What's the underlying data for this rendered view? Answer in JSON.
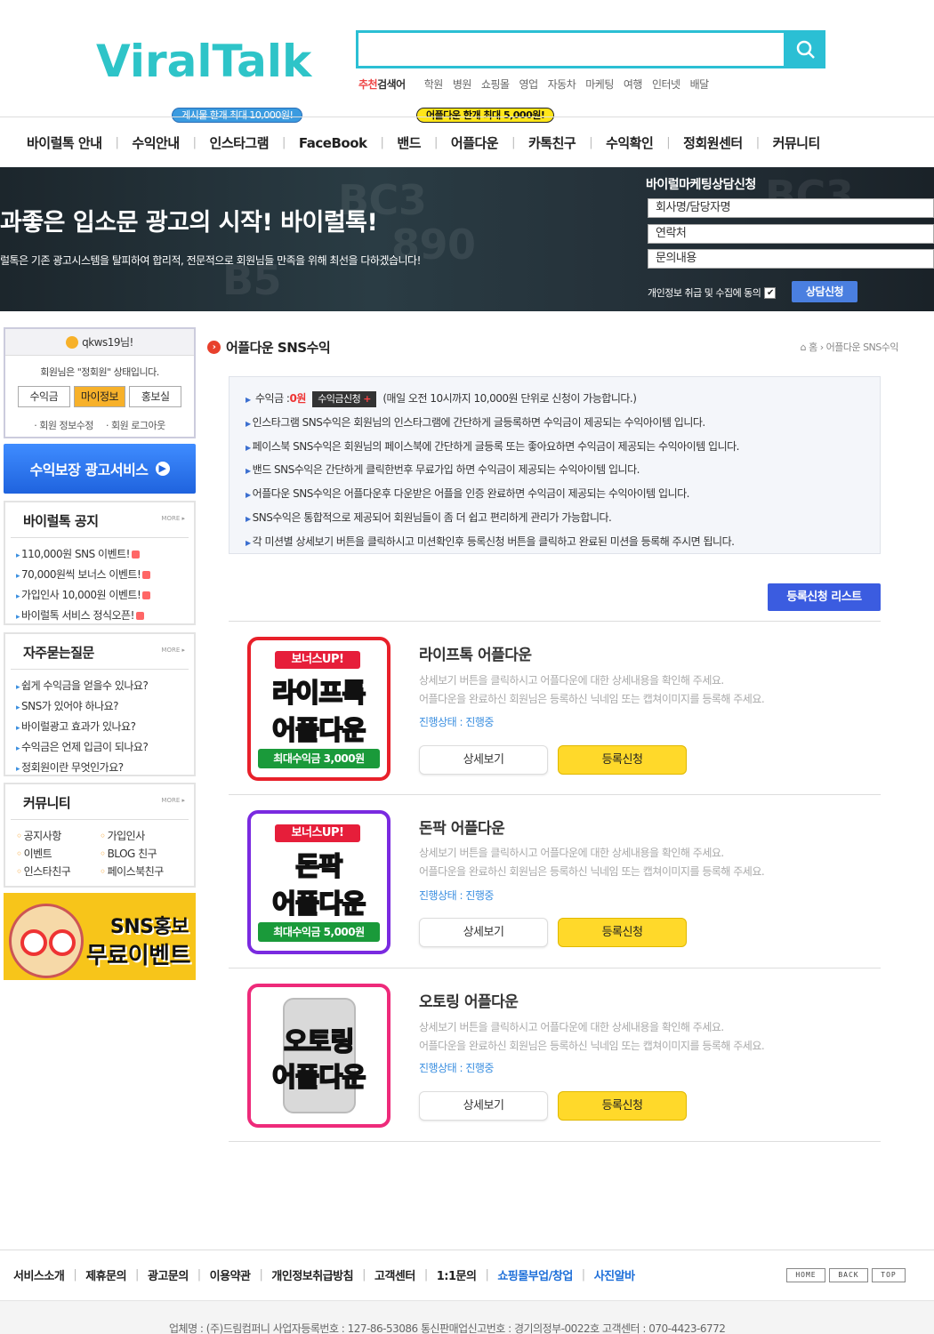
{
  "brand": {
    "logo": "ViralTalk",
    "accent": "#2bbfd4"
  },
  "search": {
    "recommend_label_1": "추천",
    "recommend_label_2": "검색어",
    "keywords": [
      "학원",
      "병원",
      "쇼핑몰",
      "영업",
      "자동차",
      "마케팅",
      "여행",
      "인터넷",
      "배달"
    ]
  },
  "bubbles": {
    "posts": "게시물 한개 최대 10,000원!",
    "appdown": "어플다운 한개 최대 5,000원!"
  },
  "nav": [
    "바이럴톡 안내",
    "수익안내",
    "인스타그램",
    "FaceBook",
    "밴드",
    "어플다운",
    "카톡친구",
    "수익확인",
    "정회원센터",
    "커뮤니티"
  ],
  "banner": {
    "title": "과좋은 입소문 광고의 시작! 바이럴톡!",
    "subtitle": "럴톡은 기존 광고시스템을 탈피하여 합리적, 전문적으로 회원님들 만족을 위해 최선을 다하겠습니다!",
    "consult_title": "바이럴마케팅상담신청",
    "fields": [
      "회사명/담당자명",
      "연락처",
      "문의내용"
    ],
    "privacy": "개인정보 취급 및 수집에 동의",
    "submit": "상담신청"
  },
  "login": {
    "user": "qkws19님!",
    "status": "회원님은 \"정회원\" 상태입니다.",
    "buttons": [
      "수익금",
      "마이정보",
      "홍보실"
    ],
    "links": [
      "· 회원 정보수정",
      "· 회원 로그아웃"
    ]
  },
  "side_banner": "수익보장 광고서비스",
  "notice": {
    "title": "바이럴톡 공지",
    "more": "MORE ▸",
    "items": [
      "110,000원 SNS 이벤트!",
      "70,000원씩 보너스 이벤트!",
      "가입인사 10,000원 이벤트!",
      "바이럴톡 서비스 정식오픈!"
    ]
  },
  "faq": {
    "title": "자주묻는질문",
    "more": "MORE ▸",
    "items": [
      "쉽게 수익금을 얻을수 있나요?",
      "SNS가 있어야 하나요?",
      "바이럴광고 효과가 있나요?",
      "수익금은 언제 입금이 되나요?",
      "정회원이란 무엇인가요?"
    ]
  },
  "community": {
    "title": "커뮤니티",
    "more": "MORE ▸",
    "items": [
      "공지사항",
      "가입인사",
      "이벤트",
      "BLOG 친구",
      "인스타친구",
      "페이스북친구"
    ]
  },
  "event_banner": {
    "line1": "SNS홍보",
    "line2": "무료이벤트"
  },
  "page": {
    "title": "어플다운 SNS수익",
    "breadcrumb": "홈 › 어플다운 SNS수익",
    "income_label": "수익금 :",
    "income_value": "0원",
    "income_button": "수익금신청",
    "income_note": "(매일 오전 10시까지 10,000원 단위로 신청이 가능합니다.)",
    "info": [
      "인스타그램 SNS수익은 회원님의 인스타그램에 간단하게 글등록하면 수익금이 제공되는 수익아이템 입니다.",
      "페이스북 SNS수익은 회원님의 페이스북에 간단하게 글등록 또는 좋아요하면 수익금이 제공되는 수익아이템 입니다.",
      "밴드 SNS수익은 간단하게 클릭한번후 무료가입 하면 수익금이 제공되는 수익아이템 입니다.",
      "어플다운 SNS수익은 어플다운후 다운받은 어플을 인증 완료하면 수익금이 제공되는 수익아이템 입니다.",
      "SNS수익은 통합적으로 제공되어 회원님들이 좀 더 쉽고 편리하게 관리가 가능합니다.",
      "각 미션별 상세보기 버튼을 클릭하시고 미션확인후 등록신청 버튼을 클릭하고 완료된 미션을 등록해 주시면 됩니다."
    ],
    "reg_list_button": "등록신청 리스트"
  },
  "items": [
    {
      "card_tag": "보너스UP!",
      "card_t1": "라이프톡",
      "card_t2": "어플다운",
      "card_bottom": "최대수익금 3,000원",
      "title": "라이프톡 어플다운",
      "desc1": "상세보기 버튼을 클릭하시고 어플다운에 대한 상세내용을 확인해 주세요.",
      "desc2": "어플다운을 완료하신 회원님은 등록하신 닉네임 또는 캡쳐이미지를 등록해 주세요.",
      "status": "진행상태 : 진행중",
      "detail": "상세보기",
      "apply": "등록신청",
      "border": "#e8202a"
    },
    {
      "card_tag": "보너스UP!",
      "card_t1": "돈팍",
      "card_t2": "어플다운",
      "card_bottom": "최대수익금 5,000원",
      "title": "돈팍 어플다운",
      "desc1": "상세보기 버튼을 클릭하시고 어플다운에 대한 상세내용을 확인해 주세요.",
      "desc2": "어플다운을 완료하신 회원님은 등록하신 닉네임 또는 캡쳐이미지를 등록해 주세요.",
      "status": "진행상태 : 진행중",
      "detail": "상세보기",
      "apply": "등록신청",
      "border": "#7a2ae0"
    },
    {
      "card_t1": "오토링",
      "card_t2": "어플다운",
      "title": "오토링 어플다운",
      "desc1": "상세보기 버튼을 클릭하시고 어플다운에 대한 상세내용을 확인해 주세요.",
      "desc2": "어플다운을 완료하신 회원님은 등록하신 닉네임 또는 캡쳐이미지를 등록해 주세요.",
      "status": "진행상태 : 진행중",
      "detail": "상세보기",
      "apply": "등록신청",
      "border": "#ee2a7a"
    }
  ],
  "footer": {
    "links": [
      "서비스소개",
      "제휴문의",
      "광고문의",
      "이용약관",
      "개인정보취급방침",
      "고객센터",
      "1:1문의"
    ],
    "blue_links": [
      "쇼핑몰부업/창업",
      "사진알바"
    ],
    "mini": [
      "HOME",
      "BACK",
      "TOP"
    ],
    "info": "업체명 : (주)드림컴퍼니   사업자등록번호 : 127-86-53086   통신판매업신고번호 : 경기의정부-0022호   고객센터 : 070-4423-6772"
  }
}
